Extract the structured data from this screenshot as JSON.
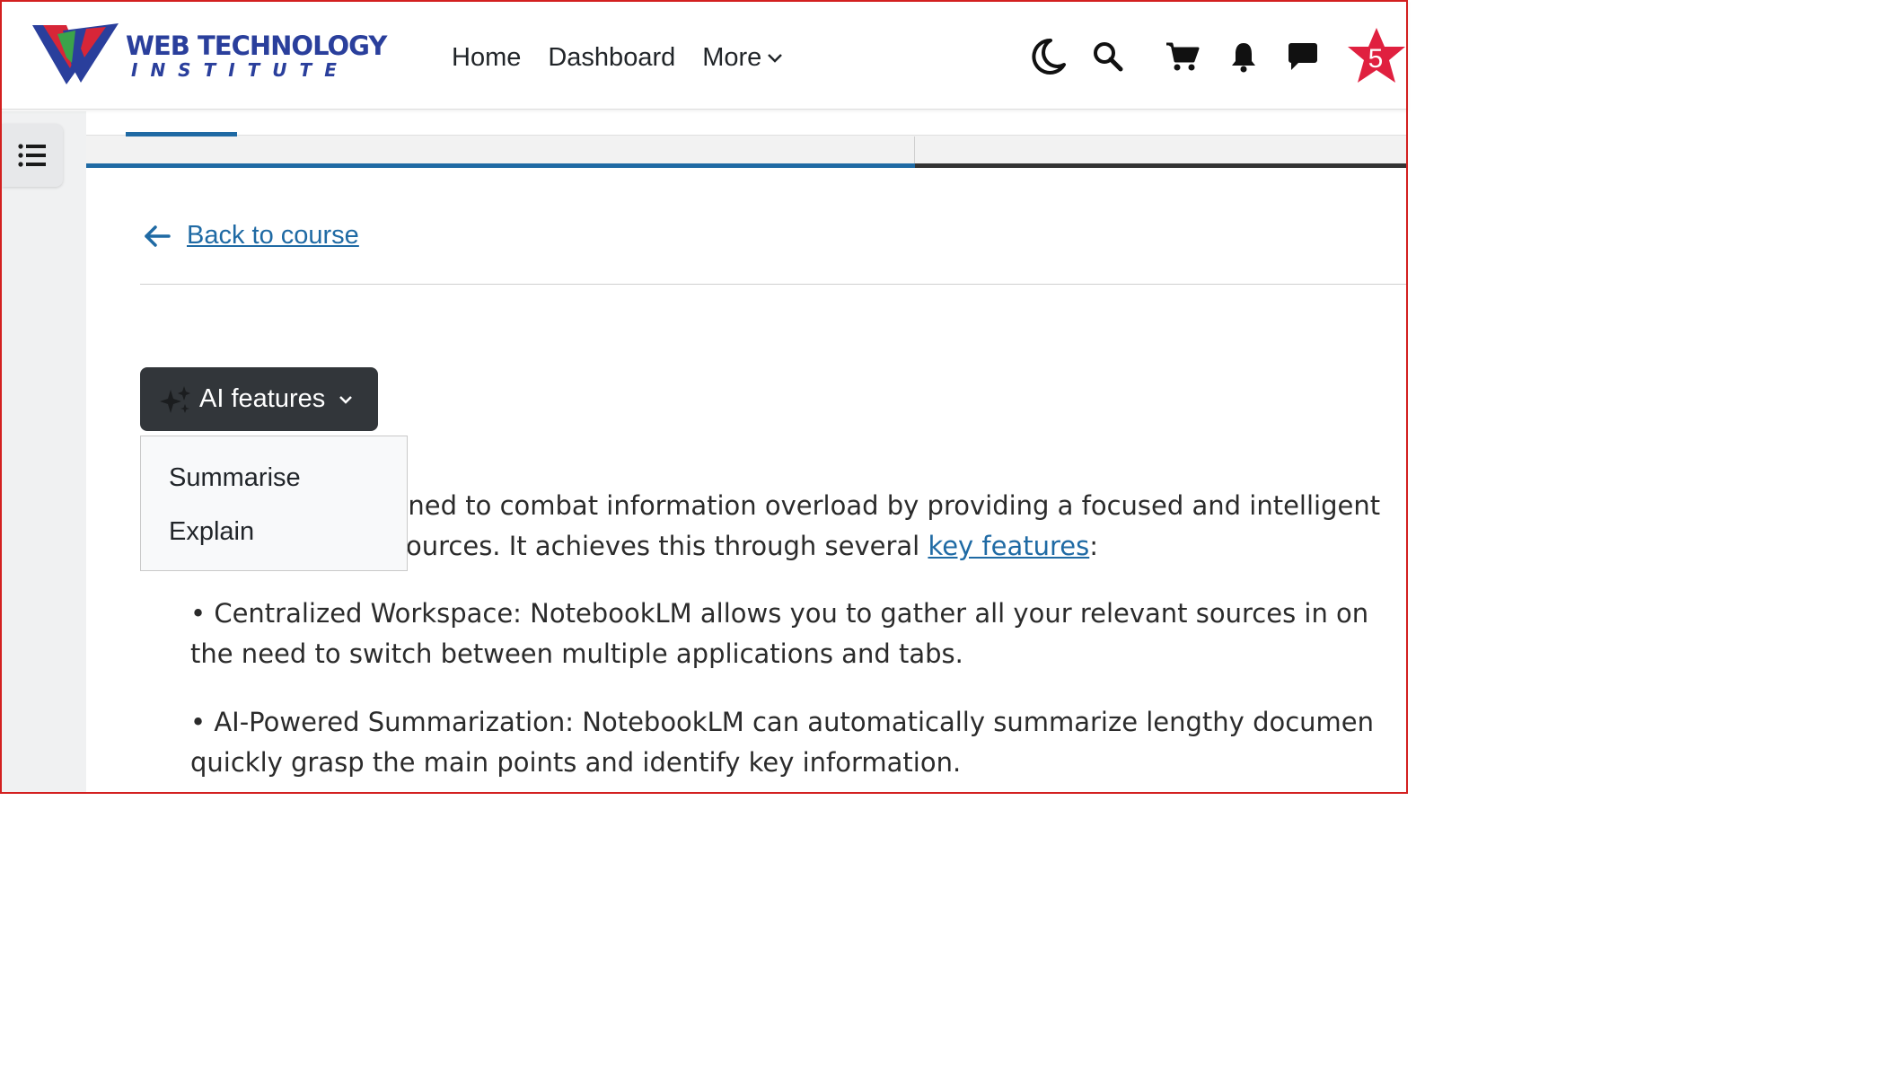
{
  "header": {
    "logo": {
      "line1": "WEB TECHNOLOGY",
      "line2": "INSTITUTE"
    },
    "nav": [
      {
        "label": "Home"
      },
      {
        "label": "Dashboard"
      },
      {
        "label": "More"
      }
    ],
    "icons": [
      "dark-mode-moon-icon",
      "search-icon",
      "cart-icon",
      "notification-bell-icon",
      "messages-icon"
    ],
    "badge_count": "5"
  },
  "course": {
    "back_label": "Back to course"
  },
  "ai": {
    "button_label": "AI features",
    "menu": [
      {
        "label": "Summarise"
      },
      {
        "label": "Explain"
      }
    ]
  },
  "content": {
    "p1_line1": "gned to combat information overload by providing a focused and intelligent",
    "p1_line2_pre": "ources. It achieves this through several ",
    "p1_link": "key features",
    "p1_line2_post": ":",
    "b1_line1": "• Centralized Workspace: NotebookLM allows you to gather all your relevant sources in on",
    "b1_line2": "the need to switch between multiple applications and tabs.",
    "b2_line1": "• AI-Powered Summarization: NotebookLM can automatically summarize lengthy documen",
    "b2_line2": "quickly grasp the main points and identify key information."
  },
  "colors": {
    "accent": "#1f6aa4",
    "button_dark": "#32363a",
    "badge": "#e0203f"
  }
}
